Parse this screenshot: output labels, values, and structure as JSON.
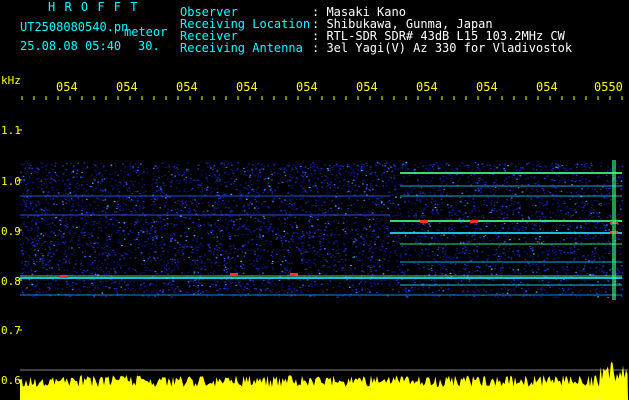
{
  "header": {
    "brand": "H R O F F T",
    "filename": "UT2508080540.pn",
    "mode": "meteor",
    "datetime": "25.08.08 05:40",
    "duration": "30.",
    "fields": [
      {
        "label": "Observer",
        "value": ": Masaki Kano"
      },
      {
        "label": "Receiving Location",
        "value": ": Shibukawa, Gunma, Japan"
      },
      {
        "label": "Receiver",
        "value": ": RTL-SDR SDR# 43dB L15 103.2MHz CW"
      },
      {
        "label": "Receiving Antenna",
        "value": ": 3el Yagi(V) Az 330 for Vladivostok"
      }
    ]
  },
  "axis": {
    "unit": "kHz",
    "y_ticks": [
      "1.1",
      "1.0",
      "0.9",
      "0.8",
      "0.7",
      "0.6"
    ],
    "x_ticks": [
      "054",
      "054",
      "054",
      "054",
      "054",
      "054",
      "054",
      "054",
      "054",
      "0550"
    ]
  },
  "colors": {
    "header_label": "#00ffff",
    "header_value": "#ffffff",
    "axis": "#ffff00",
    "background": "#000000"
  }
}
